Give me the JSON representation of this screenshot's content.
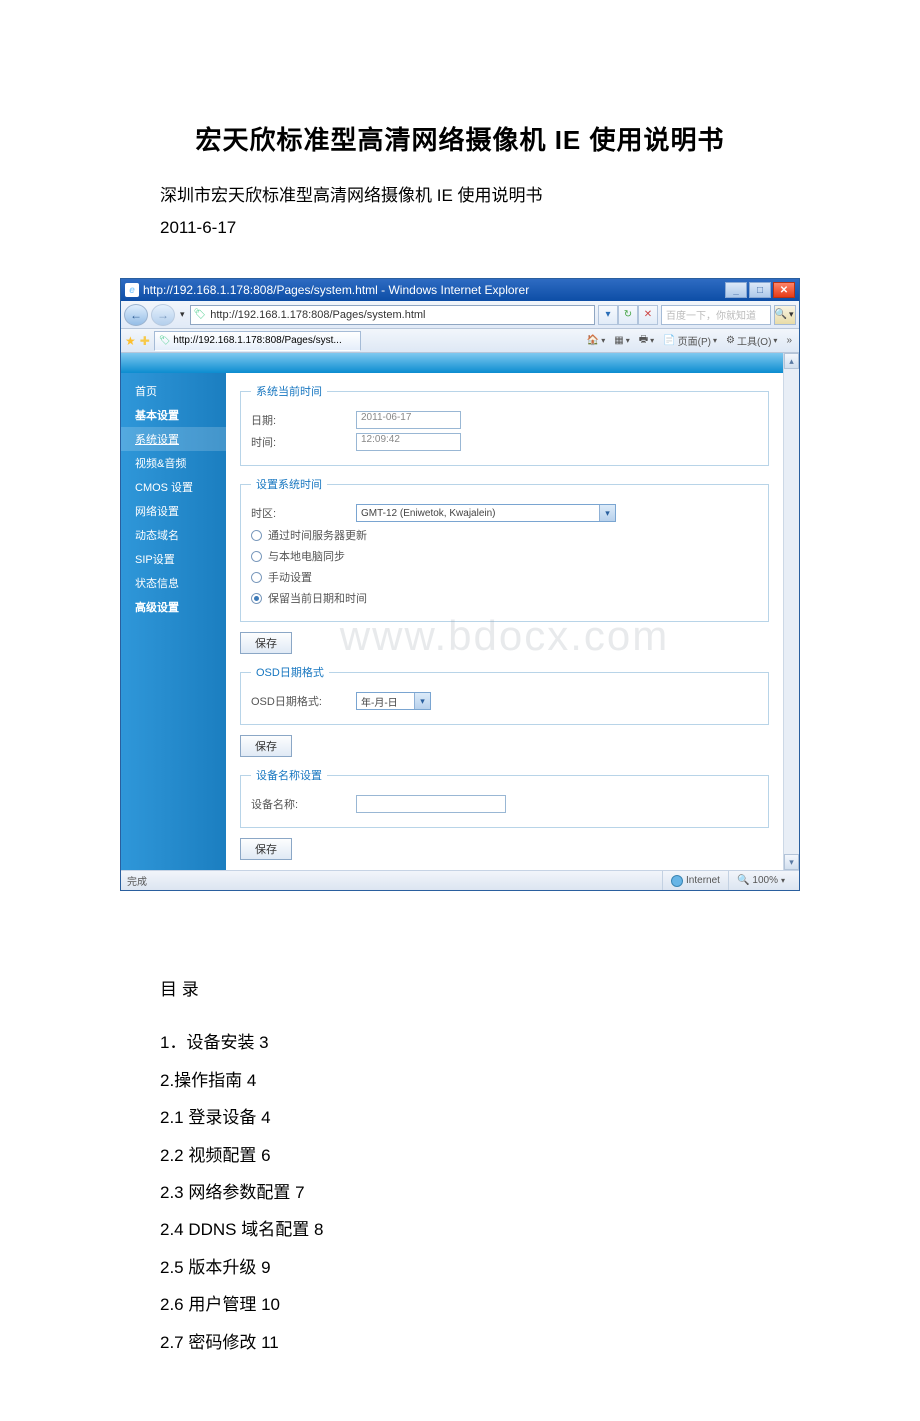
{
  "doc": {
    "title": "宏天欣标准型高清网络摄像机 IE 使用说明书",
    "subtitle": "深圳市宏天欣标准型高清网络摄像机 IE 使用说明书",
    "date": "2011-6-17"
  },
  "ie": {
    "titlebar": "http://192.168.1.178:808/Pages/system.html - Windows Internet Explorer",
    "address": "http://192.168.1.178:808/Pages/system.html",
    "search_placeholder": "百度一下，你就知道",
    "tab_label": "http://192.168.1.178:808/Pages/syst...",
    "tool_page": "页面(P)",
    "tool_tools": "工具(O)",
    "status_done": "完成",
    "status_zone": "Internet",
    "status_zoom": "100%"
  },
  "sidebar": {
    "items": [
      {
        "label": "首页",
        "bold": false
      },
      {
        "label": "基本设置",
        "bold": true
      },
      {
        "label": "系统设置",
        "bold": false,
        "active": true,
        "sel": true
      },
      {
        "label": "视频&音频",
        "bold": false
      },
      {
        "label": "CMOS 设置",
        "bold": false
      },
      {
        "label": "网络设置",
        "bold": false
      },
      {
        "label": "动态域名",
        "bold": false
      },
      {
        "label": "SIP设置",
        "bold": false
      },
      {
        "label": "状态信息",
        "bold": false
      },
      {
        "label": "高级设置",
        "bold": true
      }
    ]
  },
  "panel": {
    "current_time_legend": "系统当前时间",
    "date_label": "日期:",
    "date_value": "2011-06-17",
    "time_label": "时间:",
    "time_value": "12:09:42",
    "set_time_legend": "设置系统时间",
    "tz_label": "时区:",
    "tz_value": "GMT-12 (Eniwetok, Kwajalein)",
    "opt_ntp": "通过时间服务器更新",
    "opt_local": "与本地电脑同步",
    "opt_manual": "手动设置",
    "opt_keep": "保留当前日期和时间",
    "save_label": "保存",
    "osd_legend": "OSD日期格式",
    "osd_label": "OSD日期格式:",
    "osd_value": "年-月-日",
    "devname_legend": "设备名称设置",
    "devname_label": "设备名称:"
  },
  "watermark": "www.bdocx.com",
  "toc": {
    "heading": "目 录",
    "items": [
      "1．设备安装 3",
      "2.操作指南 4",
      "2.1 登录设备 4",
      "2.2 视频配置 6",
      "2.3 网络参数配置 7",
      "2.4 DDNS 域名配置 8",
      "2.5 版本升级 9",
      "2.6 用户管理 10",
      "2.7 密码修改 11"
    ]
  }
}
